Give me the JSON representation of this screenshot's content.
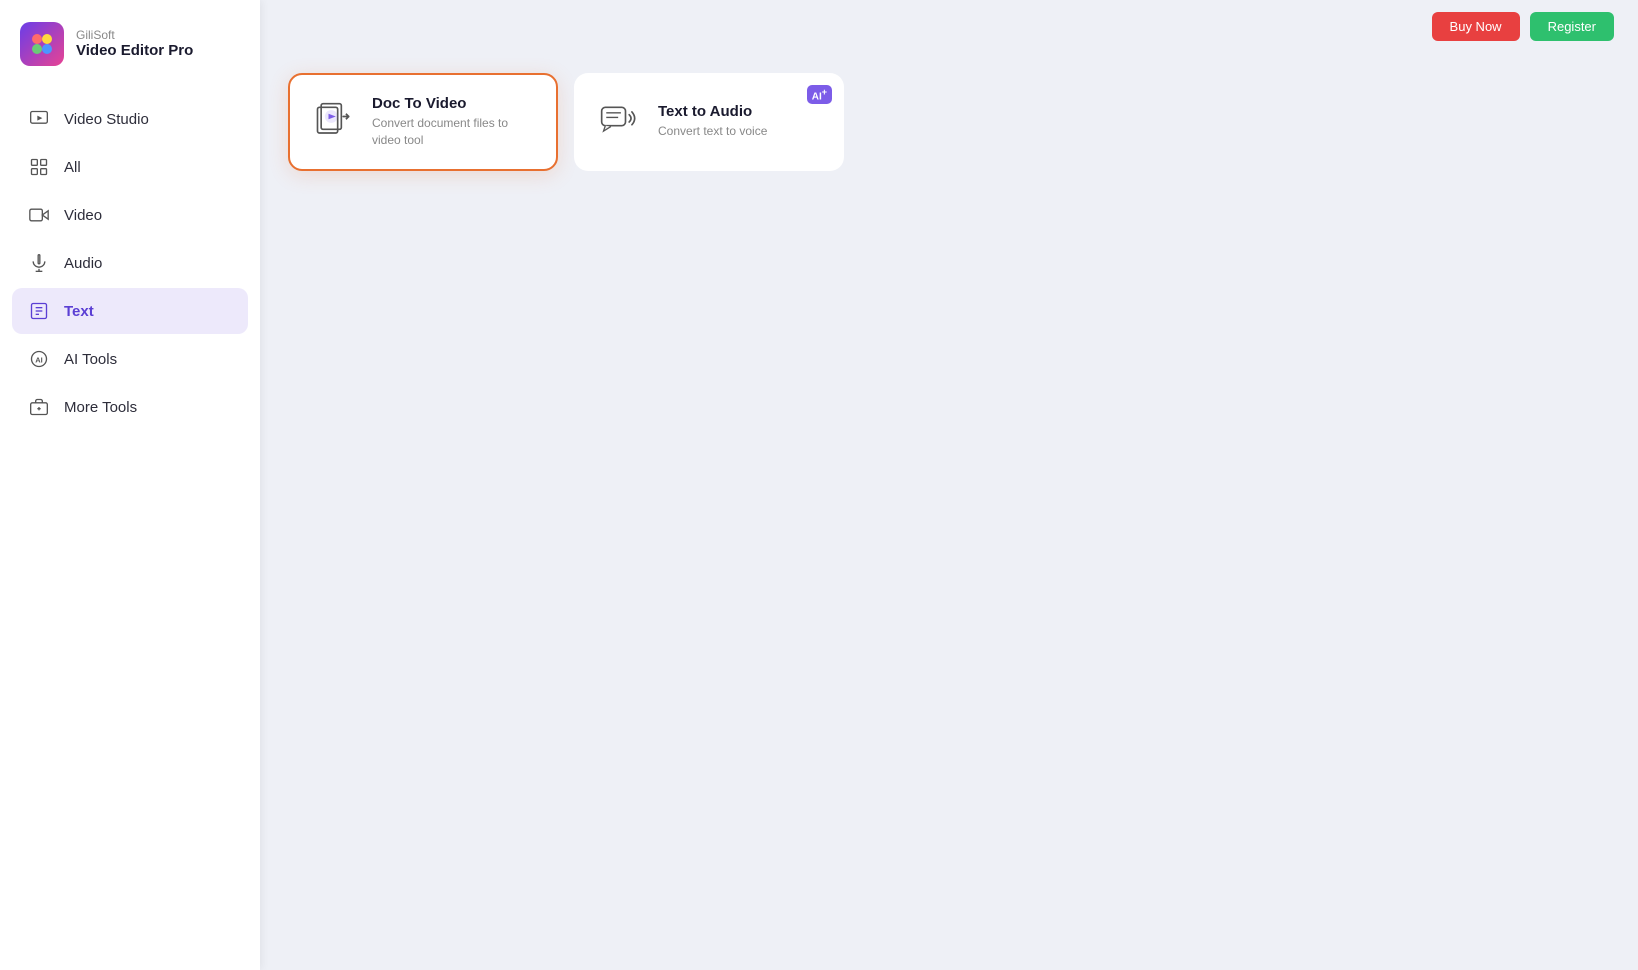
{
  "app": {
    "brand": "GiliSoft",
    "product": "Video Editor Pro"
  },
  "header": {
    "btn_buy": "Buy Now",
    "btn_register": "Register"
  },
  "sidebar": {
    "items": [
      {
        "id": "video-studio",
        "label": "Video Studio",
        "icon": "play-icon"
      },
      {
        "id": "all",
        "label": "All",
        "icon": "grid-icon"
      },
      {
        "id": "video",
        "label": "Video",
        "icon": "video-icon"
      },
      {
        "id": "audio",
        "label": "Audio",
        "icon": "audio-icon"
      },
      {
        "id": "text",
        "label": "Text",
        "icon": "text-icon",
        "active": true
      },
      {
        "id": "ai-tools",
        "label": "AI Tools",
        "icon": "ai-icon"
      },
      {
        "id": "more-tools",
        "label": "More Tools",
        "icon": "tools-icon"
      }
    ]
  },
  "tools": [
    {
      "id": "doc-to-video",
      "title": "Doc To Video",
      "desc": "Convert document files to video tool",
      "selected": true,
      "ai_badge": false
    },
    {
      "id": "text-to-audio",
      "title": "Text to Audio",
      "desc": "Convert text to voice",
      "selected": false,
      "ai_badge": true
    }
  ]
}
